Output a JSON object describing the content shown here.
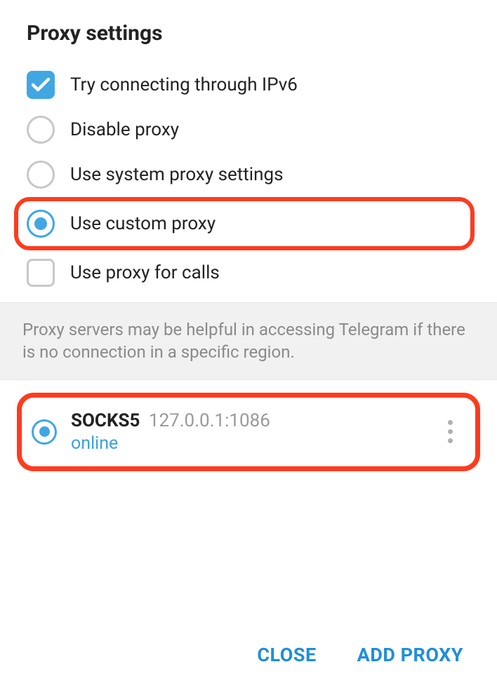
{
  "title": "Proxy settings",
  "options": {
    "ipv6": {
      "label": "Try connecting through IPv6",
      "checked": true,
      "type": "checkbox"
    },
    "disable": {
      "label": "Disable proxy",
      "selected": false,
      "type": "radio"
    },
    "system": {
      "label": "Use system proxy settings",
      "selected": false,
      "type": "radio"
    },
    "custom": {
      "label": "Use custom proxy",
      "selected": true,
      "type": "radio",
      "highlighted": true
    },
    "calls": {
      "label": "Use proxy for calls",
      "checked": false,
      "type": "checkbox"
    }
  },
  "info_text": "Proxy servers may be helpful in accessing Telegram if there is no connection in a specific region.",
  "proxy_entry": {
    "protocol": "SOCKS5",
    "address": "127.0.0.1:1086",
    "status": "online",
    "selected": true,
    "highlighted": true
  },
  "footer": {
    "close": "CLOSE",
    "add_proxy": "ADD PROXY"
  }
}
